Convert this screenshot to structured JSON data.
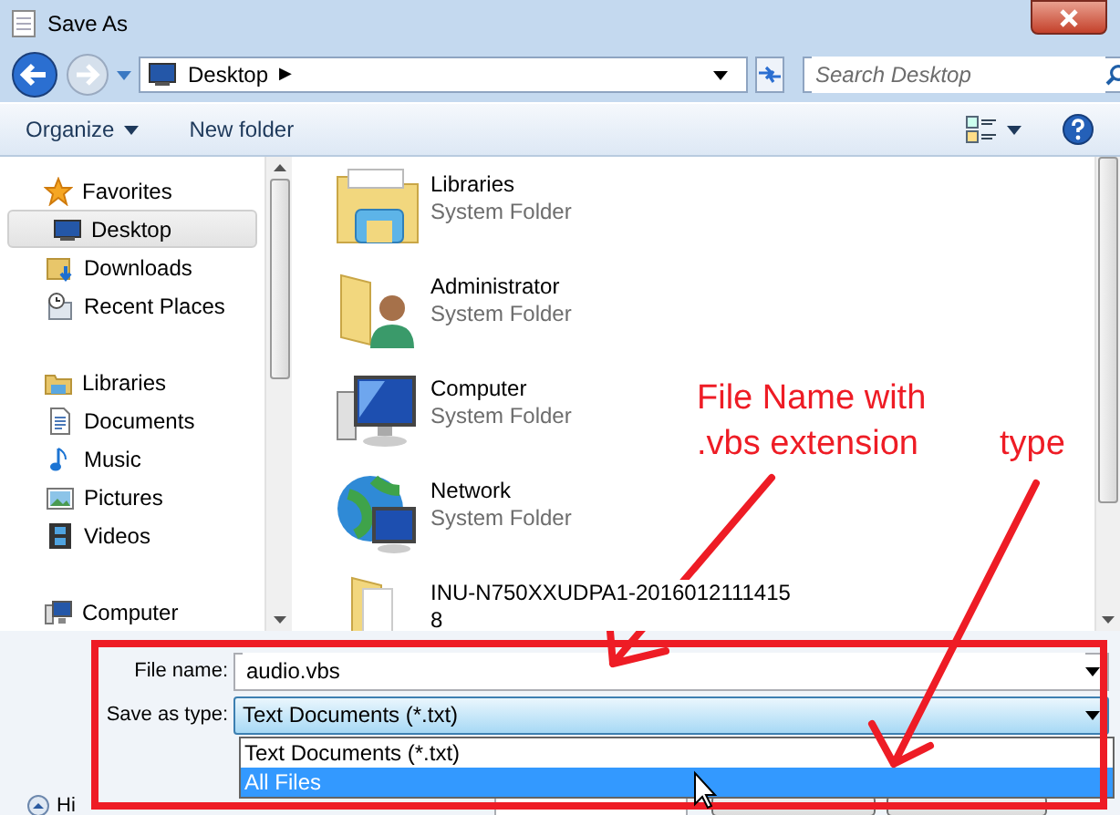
{
  "window": {
    "title": "Save As"
  },
  "address": {
    "location": "Desktop",
    "separator": "▶"
  },
  "search": {
    "placeholder": "Search Desktop"
  },
  "toolbar": {
    "buttons": [
      {
        "label": "Organize",
        "has_menu": true
      },
      {
        "label": "New folder",
        "has_menu": false
      }
    ]
  },
  "sidebar": {
    "groups": [
      {
        "label": "Favorites",
        "children": [
          {
            "label": "Desktop",
            "selected": true
          },
          {
            "label": "Downloads",
            "selected": false
          },
          {
            "label": "Recent Places",
            "selected": false
          }
        ]
      },
      {
        "label": "Libraries",
        "children": [
          {
            "label": "Documents",
            "selected": false
          },
          {
            "label": "Music",
            "selected": false
          },
          {
            "label": "Pictures",
            "selected": false
          },
          {
            "label": "Videos",
            "selected": false
          }
        ]
      },
      {
        "label": "Computer"
      }
    ]
  },
  "items": [
    {
      "name": "Libraries",
      "subtitle": "System Folder"
    },
    {
      "name": "Administrator",
      "subtitle": "System Folder"
    },
    {
      "name": "Computer",
      "subtitle": "System Folder"
    },
    {
      "name": "Network",
      "subtitle": "System Folder"
    },
    {
      "name": "INU-N750XXUDPA1-20160121114158"
    }
  ],
  "file_name": {
    "label": "File name:",
    "value": "audio.vbs"
  },
  "save_type": {
    "label": "Save as type:",
    "value": "Text Documents (*.txt)",
    "expanded": true,
    "options": [
      {
        "label": "Text Documents (*.txt)",
        "highlighted": false
      },
      {
        "label": "All Files",
        "highlighted": true
      }
    ]
  },
  "footer": {
    "hide_folders": "Hi"
  },
  "annotations": [
    {
      "lines": [
        "File Name with",
        ".vbs extension"
      ]
    },
    {
      "lines": [
        "type"
      ]
    }
  ]
}
